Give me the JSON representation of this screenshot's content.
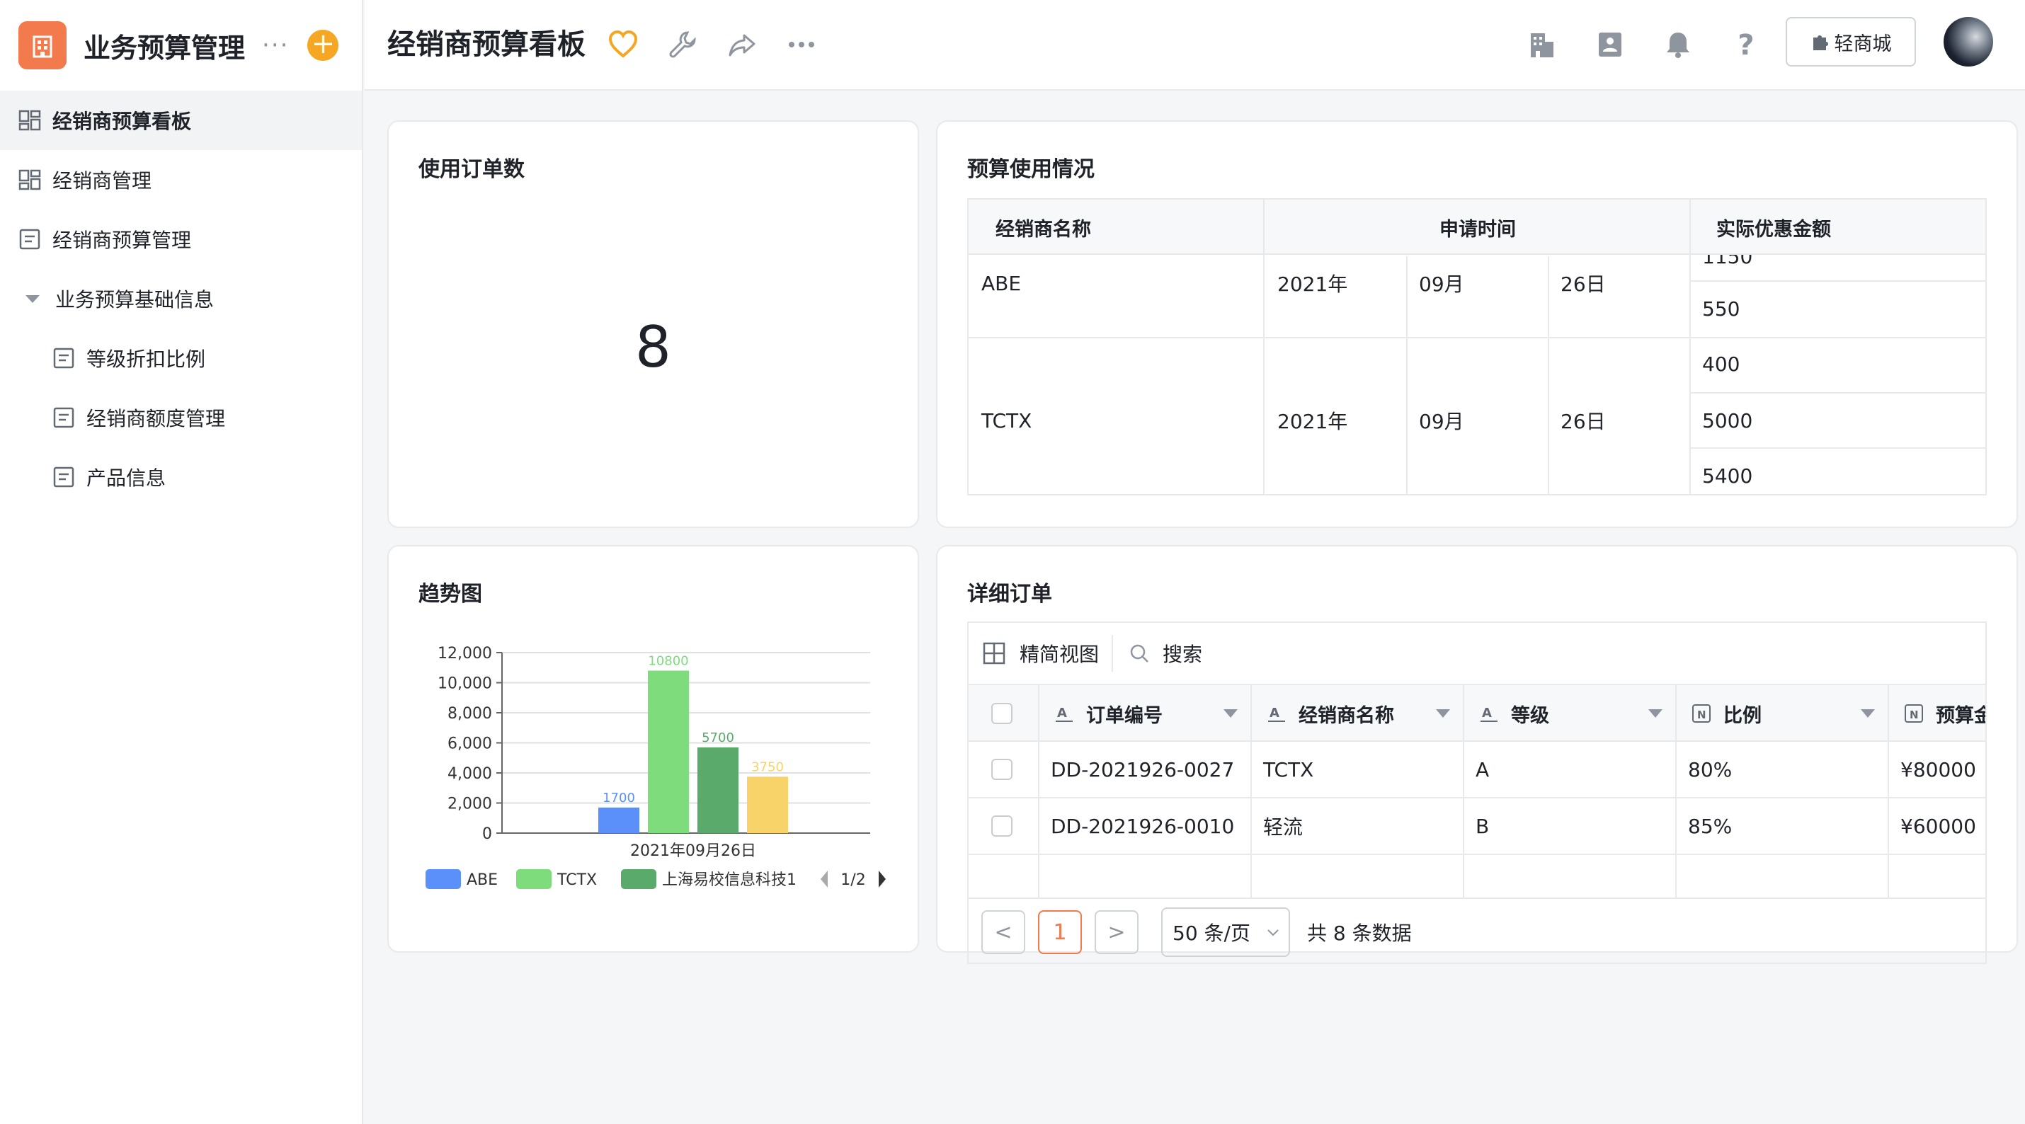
{
  "app": {
    "title": "业务预算管理",
    "more": "···",
    "add": "+"
  },
  "sidebar": {
    "items": [
      {
        "label": "经销商预算看板",
        "icon": "dashboard-icon"
      },
      {
        "label": "经销商管理",
        "icon": "dashboard-icon"
      },
      {
        "label": "经销商预算管理",
        "icon": "form-icon"
      },
      {
        "label": "业务预算基础信息",
        "icon": "caret-down-icon"
      },
      {
        "label": "等级折扣比例",
        "icon": "form-icon"
      },
      {
        "label": "经销商额度管理",
        "icon": "form-icon"
      },
      {
        "label": "产品信息",
        "icon": "form-icon"
      }
    ]
  },
  "header": {
    "title": "经销商预算看板",
    "mall_label": "轻商城",
    "colors": {
      "accent": "#f27a4d",
      "heart": "#f5a623"
    }
  },
  "order_count": {
    "title": "使用订单数",
    "value": "8"
  },
  "budget_usage": {
    "title": "预算使用情况",
    "headers": [
      "经销商名称",
      "申请时间",
      "实际优惠金额"
    ],
    "rows": [
      {
        "name": "ABE",
        "year": "2021年",
        "month": "09月",
        "day": "26日",
        "amounts": [
          "1150",
          "550"
        ]
      },
      {
        "name": "TCTX",
        "year": "2021年",
        "month": "09月",
        "day": "26日",
        "amounts": [
          "400",
          "5000",
          "5400"
        ]
      }
    ]
  },
  "trend": {
    "title": "趋势图",
    "legend_page": "1/2"
  },
  "chart_data": {
    "type": "bar",
    "categories": [
      "2021年09月26日"
    ],
    "series": [
      {
        "name": "ABE",
        "values": [
          1700
        ],
        "color": "#5b8ff9"
      },
      {
        "name": "TCTX",
        "values": [
          10800
        ],
        "color": "#7fdc7c"
      },
      {
        "name": "上海易校信息科技1",
        "values": [
          5700
        ],
        "color": "#5aab6b"
      },
      {
        "name": "",
        "values": [
          3750
        ],
        "color": "#f7d36a"
      }
    ],
    "ylim": [
      0,
      12000
    ],
    "yticks": [
      "0",
      "2,000",
      "4,000",
      "6,000",
      "8,000",
      "10,000",
      "12,000"
    ],
    "grid": true,
    "legend_position": "bottom"
  },
  "orders": {
    "title": "详细订单",
    "view_label": "精简视图",
    "search_label": "搜索",
    "columns": [
      "订单编号",
      "经销商名称",
      "等级",
      "比例",
      "预算金"
    ],
    "rows": [
      {
        "id": "DD-2021926-0027",
        "dealer": "TCTX",
        "level": "A",
        "ratio": "80%",
        "amount": "¥80000"
      },
      {
        "id": "DD-2021926-0010",
        "dealer": "轻流",
        "level": "B",
        "ratio": "85%",
        "amount": "¥60000"
      }
    ],
    "pager": {
      "prev": "<",
      "current": "1",
      "next": ">",
      "page_size": "50 条/页",
      "total": "共 8 条数据"
    }
  }
}
